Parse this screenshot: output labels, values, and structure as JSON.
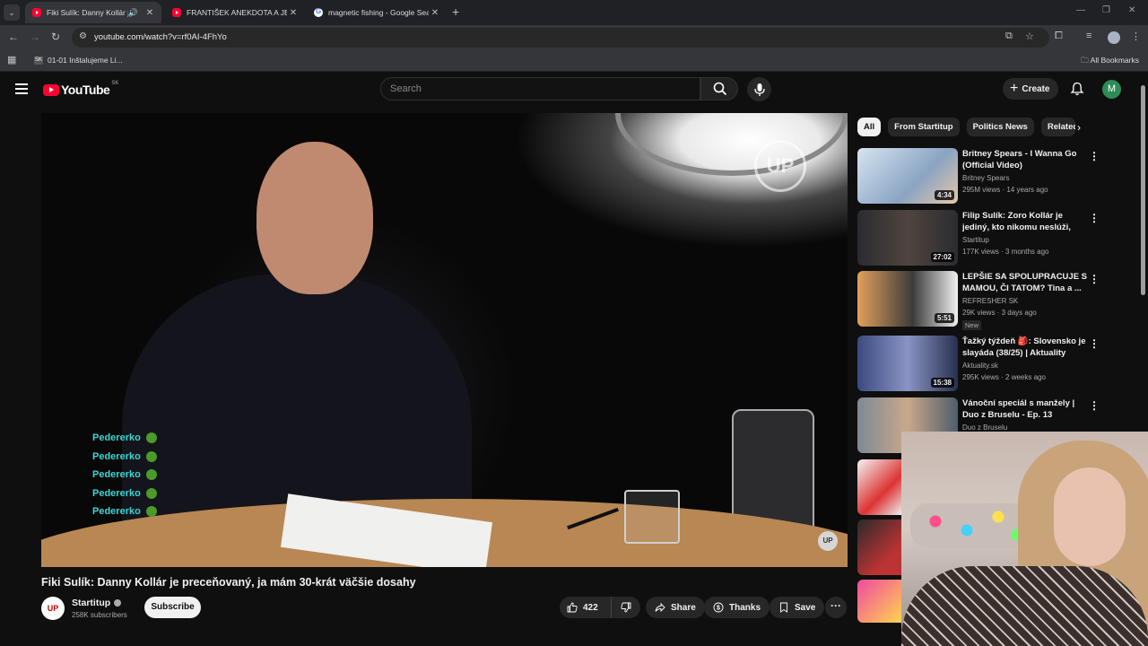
{
  "browser": {
    "tabs": [
      {
        "label": "Fiki Sulík: Danny Kollár je pr",
        "active": true,
        "favicon": "youtube"
      },
      {
        "label": "FRANTIŠEK ANEKDOTA A JEHO",
        "active": false,
        "favicon": "youtube"
      },
      {
        "label": "magnetic fishing - Google Sear",
        "active": false,
        "favicon": "google"
      }
    ],
    "url": "youtube.com/watch?v=rf0AI-4FhYo",
    "bookmarks": [
      {
        "label": "01-01 Inštalujeme Li..."
      }
    ],
    "all_bookmarks_label": "All Bookmarks"
  },
  "youtube": {
    "logo_text": "YouTube",
    "country_code": "SK",
    "search_placeholder": "Search",
    "create_label": "Create",
    "user_initial": "M"
  },
  "video": {
    "title": "Fiki Sulík: Danny Kollár je preceňovaný, ja mám 30-krát väčšie dosahy",
    "channel": "Startitup",
    "channel_avatar_text": "UP",
    "subscribers": "258K subscribers",
    "subscribe_label": "Subscribe",
    "likes": "422",
    "share_label": "Share",
    "thanks_label": "Thanks",
    "save_label": "Save",
    "watermark": "UP",
    "corner_badge": "UP",
    "chat_overlay": [
      "Pedererko",
      "Pedererko",
      "Pedererko",
      "Pedererko",
      "Pedererko"
    ]
  },
  "chips": [
    "All",
    "From Startitup",
    "Politics News",
    "Related"
  ],
  "recommendations": [
    {
      "title": "Britney Spears - I Wanna Go (Official Video)",
      "channel": "Britney Spears",
      "meta": "295M views · 14 years ago",
      "duration": "4:34",
      "thumb_color": "#9fb3c9",
      "new": ""
    },
    {
      "title": "Filip Sulík: Zoro Kollár je jediný, kto nikomu neslúži, peniaze h...",
      "channel": "Startitup",
      "meta": "177K views · 3 months ago",
      "duration": "27:02",
      "thumb_color": "#3b3a3e",
      "new": ""
    },
    {
      "title": "LEPŠIE SA SPOLUPRACUJE S MAMOU, ČI TATOM? Tina a ...",
      "channel": "REFRESHER SK",
      "meta": "29K views · 3 days ago",
      "duration": "5:51",
      "thumb_color": "#c98a54",
      "new": "New"
    },
    {
      "title": "Ťažký týždeň 🎒: Slovensko je slayáda (38/25) | Aktuality",
      "channel": "Aktuality.sk",
      "meta": "295K views · 2 weeks ago",
      "duration": "15:38",
      "thumb_color": "#4a5a8a",
      "new": ""
    },
    {
      "title": "Vánoční speciál s manžely | Duo z Bruselu - Ep. 13",
      "channel": "Duo z Bruselu",
      "meta": "",
      "duration": "",
      "thumb_color": "#6c7b88",
      "new": ""
    }
  ]
}
